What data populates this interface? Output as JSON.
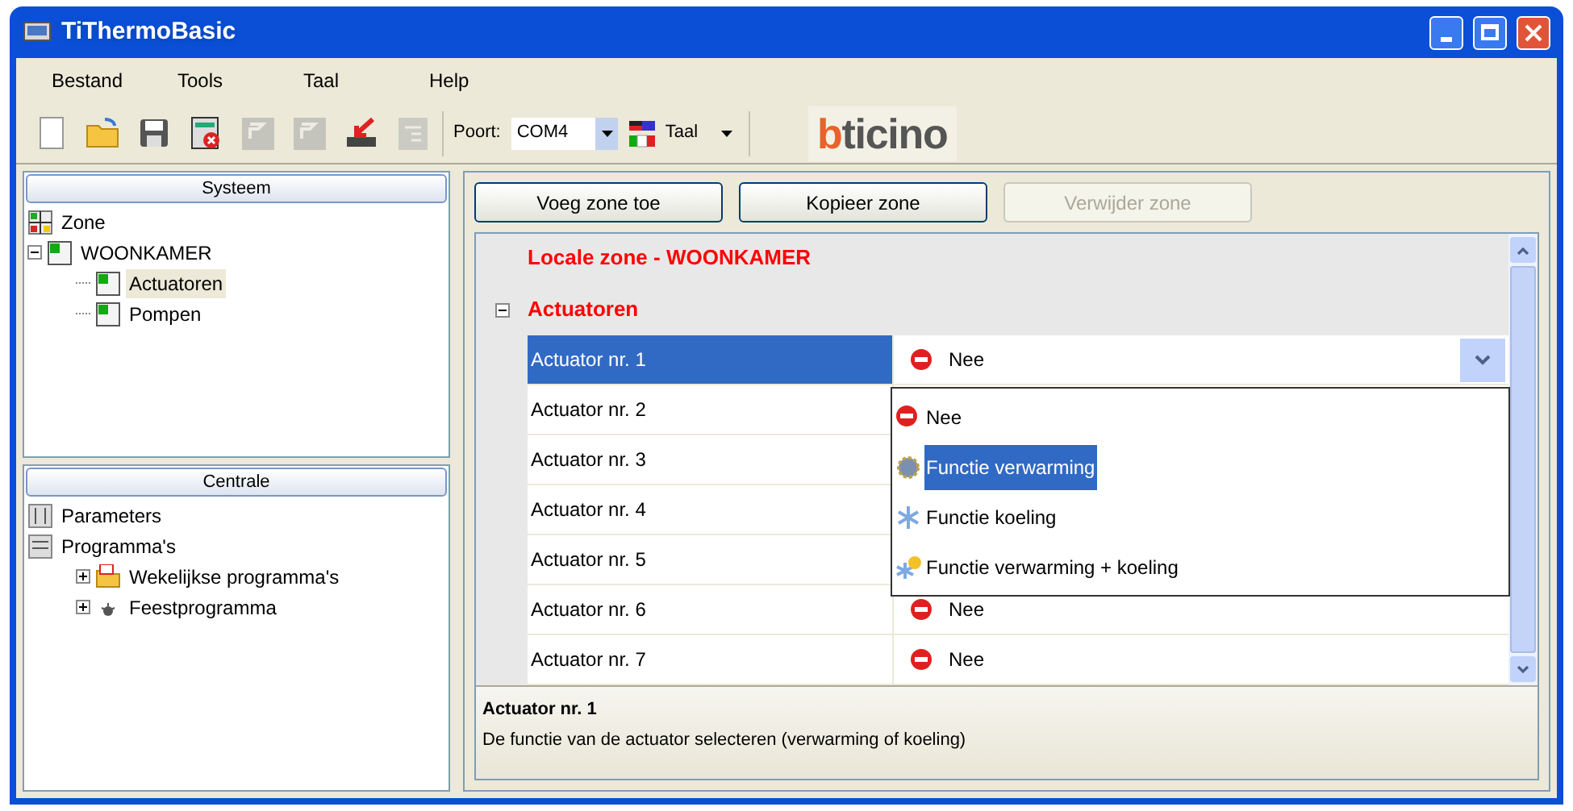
{
  "window": {
    "title": "TiThermoBasic"
  },
  "menu": [
    "Bestand",
    "Tools",
    "Taal",
    "Help"
  ],
  "toolbar": [
    {
      "kind": "new",
      "disabled": false
    },
    {
      "kind": "open",
      "disabled": false
    },
    {
      "kind": "save",
      "disabled": false
    },
    {
      "kind": "delete",
      "disabled": false
    },
    {
      "kind": "flag",
      "disabled": true
    },
    {
      "kind": "flag",
      "disabled": true
    },
    {
      "kind": "download",
      "disabled": false
    },
    {
      "kind": "list",
      "disabled": true
    }
  ],
  "port": {
    "label": "Poort:",
    "value": "COM4"
  },
  "language": {
    "label": "Taal"
  },
  "logo": "bticino",
  "system_panel": {
    "title": "Systeem",
    "tree": [
      {
        "label": "Zone",
        "kind": "zone",
        "selected": false
      },
      {
        "label": "WOONKAMER",
        "kind": "room",
        "selected": false,
        "expanded": true,
        "children": [
          {
            "label": "Actuatoren",
            "kind": "room",
            "selected": true
          },
          {
            "label": "Pompen",
            "kind": "room",
            "selected": false
          }
        ]
      }
    ]
  },
  "central_panel": {
    "title": "Centrale",
    "tree": [
      {
        "label": "Parameters",
        "kind": "params"
      },
      {
        "label": "Programma's",
        "kind": "programs",
        "children": [
          {
            "label": "Wekelijkse programma's",
            "kind": "weekly",
            "expanded": false
          },
          {
            "label": "Feestprogramma",
            "kind": "party",
            "expanded": false
          }
        ]
      }
    ]
  },
  "buttons": [
    {
      "label": "Voeg zone toe",
      "disabled": false
    },
    {
      "label": "Kopieer zone",
      "disabled": false
    },
    {
      "label": "Verwijder zone",
      "disabled": true
    }
  ],
  "grid": {
    "heading": "Locale zone - WOONKAMER",
    "category": {
      "label": "Actuatoren",
      "expanded": true
    },
    "rows": [
      {
        "name": "Actuator nr. 1",
        "value": "Nee",
        "kind": "no",
        "selected": true
      },
      {
        "name": "Actuator nr. 2",
        "selected": false
      },
      {
        "name": "Actuator nr. 3",
        "selected": false
      },
      {
        "name": "Actuator nr. 4",
        "selected": false
      },
      {
        "name": "Actuator nr. 5",
        "selected": false
      },
      {
        "name": "Actuator nr. 6",
        "value": "Nee",
        "kind": "no",
        "selected": false
      },
      {
        "name": "Actuator nr. 7",
        "value": "Nee",
        "kind": "no",
        "selected": false
      }
    ],
    "dropdown": [
      {
        "label": "Nee",
        "kind": "no",
        "selected": false
      },
      {
        "label": "Functie verwarming",
        "kind": "heat",
        "selected": true
      },
      {
        "label": "Functie koeling",
        "kind": "cool",
        "selected": false
      },
      {
        "label": "Functie verwarming + koeling",
        "kind": "both",
        "selected": false
      }
    ]
  },
  "description": {
    "title": "Actuator nr. 1",
    "text": "De functie van de actuator selecteren (verwarming of koeling)"
  }
}
